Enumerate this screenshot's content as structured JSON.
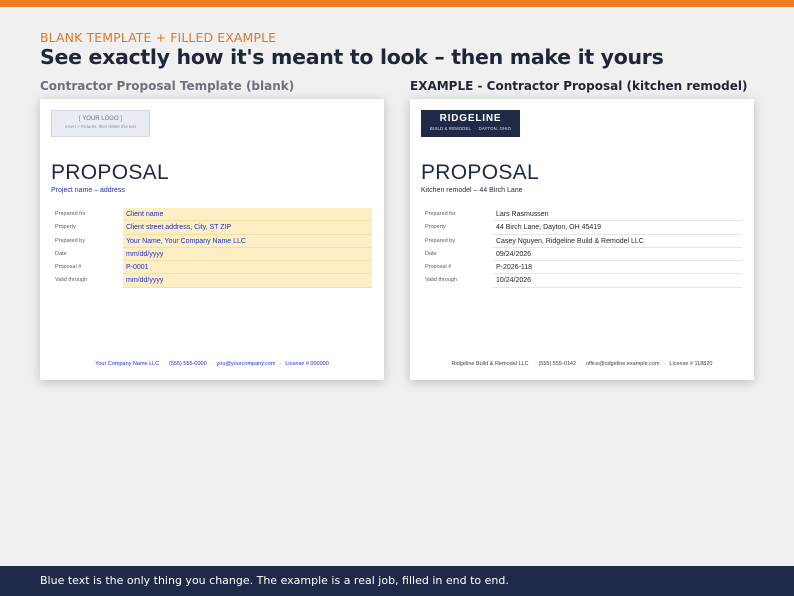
{
  "colors": {
    "accent_orange": "#ee7a22",
    "navy": "#1e2a48",
    "editable_blue": "#1a2fd4",
    "field_fill": "#fdefc3"
  },
  "header": {
    "eyebrow": "BLANK TEMPLATE  +  FILLED EXAMPLE",
    "headline": "See exactly how it's meant to look – then make it yours"
  },
  "left_panel": {
    "label": "Contractor Proposal Template (blank)",
    "logo_line1": "[ YOUR LOGO ]",
    "logo_line2": "Insert > Pictures, then delete this text",
    "title": "PROPOSAL",
    "subtitle": "Project name – address",
    "fields": [
      {
        "label": "Prepared for",
        "value": "Client name"
      },
      {
        "label": "Property",
        "value": "Client street address, City, ST ZIP"
      },
      {
        "label": "Prepared by",
        "value": "Your Name, Your Company Name LLC"
      },
      {
        "label": "Date",
        "value": "mm/dd/yyyy"
      },
      {
        "label": "Proposal #",
        "value": "P-0001"
      },
      {
        "label": "Valid through",
        "value": "mm/dd/yyyy"
      }
    ],
    "footer": {
      "company": "Your Company Name LLC",
      "phone": "(555) 555-0000",
      "email": "you@yourcompany.com",
      "license": "License # 000000"
    }
  },
  "right_panel": {
    "label": "EXAMPLE - Contractor Proposal (kitchen remodel)",
    "brand_name": "RIDGELINE",
    "brand_tag_left": "BUILD & REMODEL",
    "brand_tag_right": "DAYTON, OHIO",
    "title": "PROPOSAL",
    "subtitle": "Kitchen remodel – 44 Birch Lane",
    "fields": [
      {
        "label": "Prepared for",
        "value": "Lars Rasmussen"
      },
      {
        "label": "Property",
        "value": "44 Birch Lane, Dayton, OH 45419"
      },
      {
        "label": "Prepared by",
        "value": "Casey Nguyen, Ridgeline Build & Remodel LLC"
      },
      {
        "label": "Date",
        "value": "09/24/2026"
      },
      {
        "label": "Proposal #",
        "value": "P-2026-118"
      },
      {
        "label": "Valid through",
        "value": "10/24/2026"
      }
    ],
    "footer": {
      "company": "Ridgeline Build & Remodel LLC",
      "phone": "(555) 555-0142",
      "email": "office@ridgeline.example.com",
      "license": "License # 118820"
    }
  },
  "bottom": {
    "note": "Blue text is the only thing you change. The example is a real job, filled in end to end."
  }
}
